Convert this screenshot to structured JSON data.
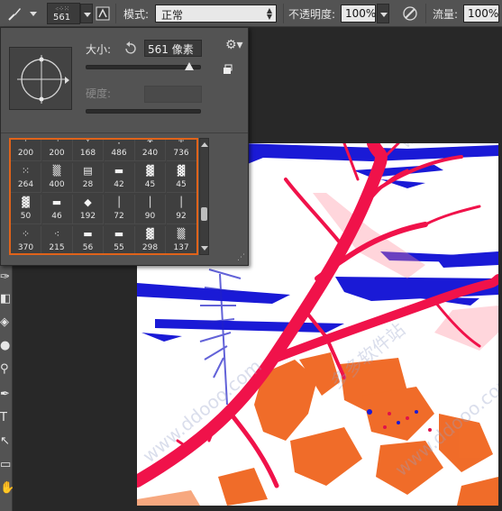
{
  "options_bar": {
    "brush_preview_size": "561",
    "mode_label": "模式:",
    "mode_value": "正常",
    "opacity_label": "不透明度:",
    "opacity_value": "100%",
    "flow_label": "流量:",
    "flow_value": "100%"
  },
  "brush_picker": {
    "size_label": "大小:",
    "size_value": "561 像素",
    "size_level": 0.9,
    "hardness_label": "硬度:",
    "hardness_value": "",
    "presets": [
      {
        "glyph": "⁘",
        "size": "200"
      },
      {
        "glyph": "⁖",
        "size": "200"
      },
      {
        "glyph": "✧",
        "size": "168"
      },
      {
        "glyph": "⁛",
        "size": "486"
      },
      {
        "glyph": "❉",
        "size": "240"
      },
      {
        "glyph": "⁜",
        "size": "736"
      },
      {
        "glyph": "⁙",
        "size": "264"
      },
      {
        "glyph": "▒",
        "size": "400"
      },
      {
        "glyph": "▤",
        "size": "28"
      },
      {
        "glyph": "▬",
        "size": "42"
      },
      {
        "glyph": "▓",
        "size": "45"
      },
      {
        "glyph": "▓",
        "size": "45"
      },
      {
        "glyph": "▓",
        "size": "50"
      },
      {
        "glyph": "▬",
        "size": "46"
      },
      {
        "glyph": "◆",
        "size": "192"
      },
      {
        "glyph": "│",
        "size": "72"
      },
      {
        "glyph": "│",
        "size": "90"
      },
      {
        "glyph": "│",
        "size": "92"
      },
      {
        "glyph": "⁘",
        "size": "370"
      },
      {
        "glyph": "⁖",
        "size": "215"
      },
      {
        "glyph": "▬",
        "size": "56"
      },
      {
        "glyph": "▬",
        "size": "55"
      },
      {
        "glyph": "▓",
        "size": "298"
      },
      {
        "glyph": "▒",
        "size": "137"
      }
    ]
  },
  "tools": [
    {
      "icon": "quick-select-icon",
      "glyph": "✑"
    },
    {
      "icon": "eraser-icon",
      "glyph": "◧"
    },
    {
      "icon": "paint-bucket-icon",
      "glyph": "◈"
    },
    {
      "icon": "blur-icon",
      "glyph": "●"
    },
    {
      "icon": "dodge-icon",
      "glyph": "⚲"
    },
    {
      "icon": "pen-icon",
      "glyph": "✒"
    },
    {
      "icon": "type-icon",
      "glyph": "T"
    },
    {
      "icon": "path-select-icon",
      "glyph": "↖"
    },
    {
      "icon": "rectangle-icon",
      "glyph": "▭"
    },
    {
      "icon": "hand-icon",
      "glyph": "✋"
    }
  ],
  "canvas": {
    "watermarks": [
      "多多软件站",
      "www.ddooo.com",
      "www.ddooo.com",
      "www.ddooo.com"
    ]
  }
}
